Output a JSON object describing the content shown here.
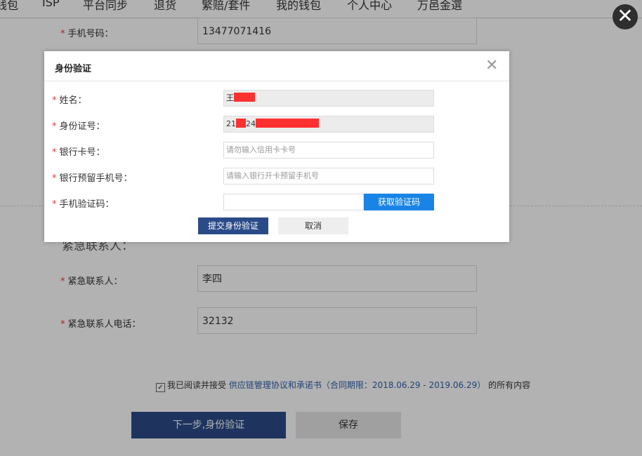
{
  "nav": {
    "items": [
      "钱包",
      "ISP",
      "平台同步",
      "退货",
      "繁赔/套件",
      "我的钱包",
      "个人中心",
      "万邑金選"
    ]
  },
  "form": {
    "phone": {
      "label": "手机号码：",
      "value": "13477071416"
    },
    "section_title": "紧急联系人：",
    "emergency_contact": {
      "label": "紧急联系人：",
      "value": "李四"
    },
    "emergency_phone": {
      "label": "紧急联系人电话：",
      "value": "32132"
    }
  },
  "agreement": {
    "prefix": "我已阅读并接受",
    "link": "供应链管理协议和承诺书",
    "period": "（合同期限：2018.06.29 - 2019.06.29）",
    "suffix": "的所有内容"
  },
  "buttons": {
    "next": "下一步,身份验证",
    "save": "保存"
  },
  "dialog": {
    "title": "身份验证",
    "close": "✕",
    "fields": {
      "name": {
        "label": "姓名：",
        "value": "王"
      },
      "id_number": {
        "label": "身份证号：",
        "value_prefix": "21",
        "value_mid": "24"
      },
      "bank_card": {
        "label": "银行卡号：",
        "placeholder": "请勿输入信用卡卡号"
      },
      "bank_phone": {
        "label": "银行预留手机号：",
        "placeholder": "请输入银行开卡预留手机号"
      },
      "sms_code": {
        "label": "手机验证码：",
        "placeholder": ""
      }
    },
    "get_code": "获取验证码",
    "submit": "提交身份验证",
    "cancel": "取消"
  },
  "overlay_close": "✕",
  "colors": {
    "primary_dark_blue": "#2b4b88",
    "primary_blue": "#1a84e6",
    "required_star": "#e4393c",
    "redaction": "#ff3030"
  }
}
